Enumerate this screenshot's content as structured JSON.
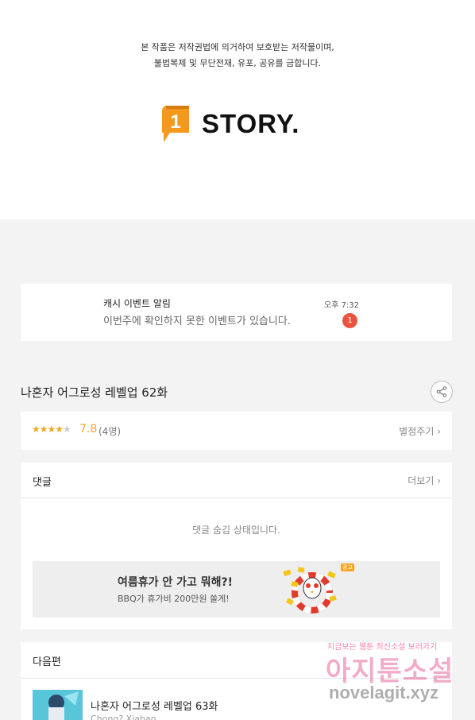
{
  "copyright": {
    "line1": "본 작품은 저작권법에 의거하여 보호받는 저작물이며,",
    "line2": "불법복제 및 무단전재, 유포, 공유를 금합니다."
  },
  "logo": {
    "mark": "1",
    "text": "STORY."
  },
  "notification": {
    "title": "캐시 이벤트 알림",
    "body": "이번주에 확인하지 못한 이벤트가 있습니다.",
    "time": "오후 7:32",
    "badge": "1"
  },
  "episode": {
    "title": "나혼자 어그로성 레벨업 62화",
    "share_icon": "share-icon"
  },
  "rating": {
    "stars_filled": "★★★★",
    "stars_empty": "★",
    "stars_value": 4,
    "score": "7.8",
    "count": "(4명)",
    "rate_label": "별점주기 ›"
  },
  "comments": {
    "title": "댓글",
    "more_label": "더보기 ›",
    "hidden_message": "댓글 숨김 상태입니다."
  },
  "ad": {
    "title": "여름휴가 안 가고 뭐해?!",
    "subtitle": "BBQ가 휴가비 200만원 쏠게!",
    "badge": "광고"
  },
  "next": {
    "title": "다음편",
    "episode_title": "나혼자 어그로성 레벨업 63화",
    "author": "Chong? Xiabao"
  },
  "watermark": {
    "top": "지금보는 웹툰 최신소설 보러가기",
    "main": "아지툰소설",
    "url": "novelagit.xyz"
  },
  "colors": {
    "accent_orange": "#f5a623",
    "badge_red": "#e8543f",
    "logo_orange": "#f39a1e",
    "background": "#f3f3f3"
  }
}
